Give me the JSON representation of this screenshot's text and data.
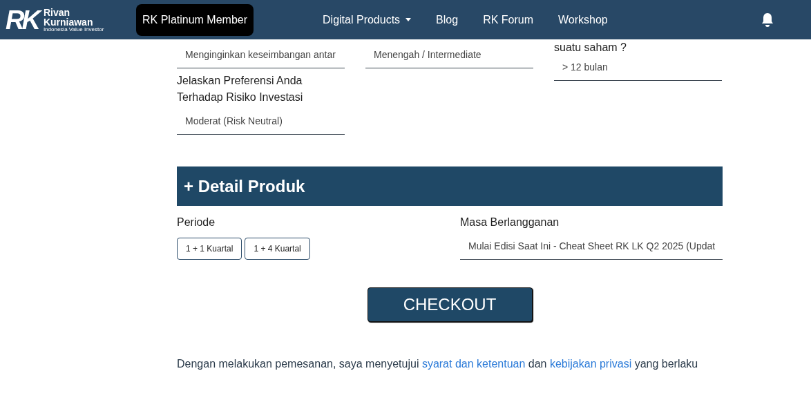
{
  "navbar": {
    "logo": {
      "mark": "RK",
      "line1": "Rivan",
      "line2": "Kurniawan",
      "tagline": "Indonesia Value Investor"
    },
    "member_badge": "RK Platinum Member",
    "links": [
      {
        "label": "Digital Products",
        "dropdown": true
      },
      {
        "label": "Blog",
        "dropdown": false
      },
      {
        "label": "RK Forum",
        "dropdown": false
      },
      {
        "label": "Workshop",
        "dropdown": false
      }
    ]
  },
  "profile_fields": [
    {
      "value": "Menginginkan keseimbangan antar"
    },
    {
      "value": "Menengah / Intermediate"
    },
    {
      "label": "suatu saham ?",
      "value": "> 12 bulan"
    }
  ],
  "risk_field": {
    "label": "Jelaskan Preferensi Anda Terhadap Risiko Investasi",
    "value": "Moderat (Risk Neutral)"
  },
  "section_title": "+ Detail Produk",
  "periode": {
    "label": "Periode",
    "options": [
      {
        "label": "1 + 1 Kuartal",
        "selected": false
      },
      {
        "label": "1 + 4 Kuartal",
        "selected": false
      }
    ]
  },
  "subscription": {
    "label": "Masa Berlangganan",
    "value": "Mulai Edisi Saat Ini - Cheat Sheet RK LK Q2 2025 (Updat"
  },
  "checkout_button": "CHECKOUT",
  "agreement": {
    "before": "Dengan melakukan pemesanan, saya menyetujui ",
    "link1": "syarat dan ketentuan",
    "middle": " dan ",
    "link2": "kebijakan privasi",
    "after": " yang berlaku"
  }
}
